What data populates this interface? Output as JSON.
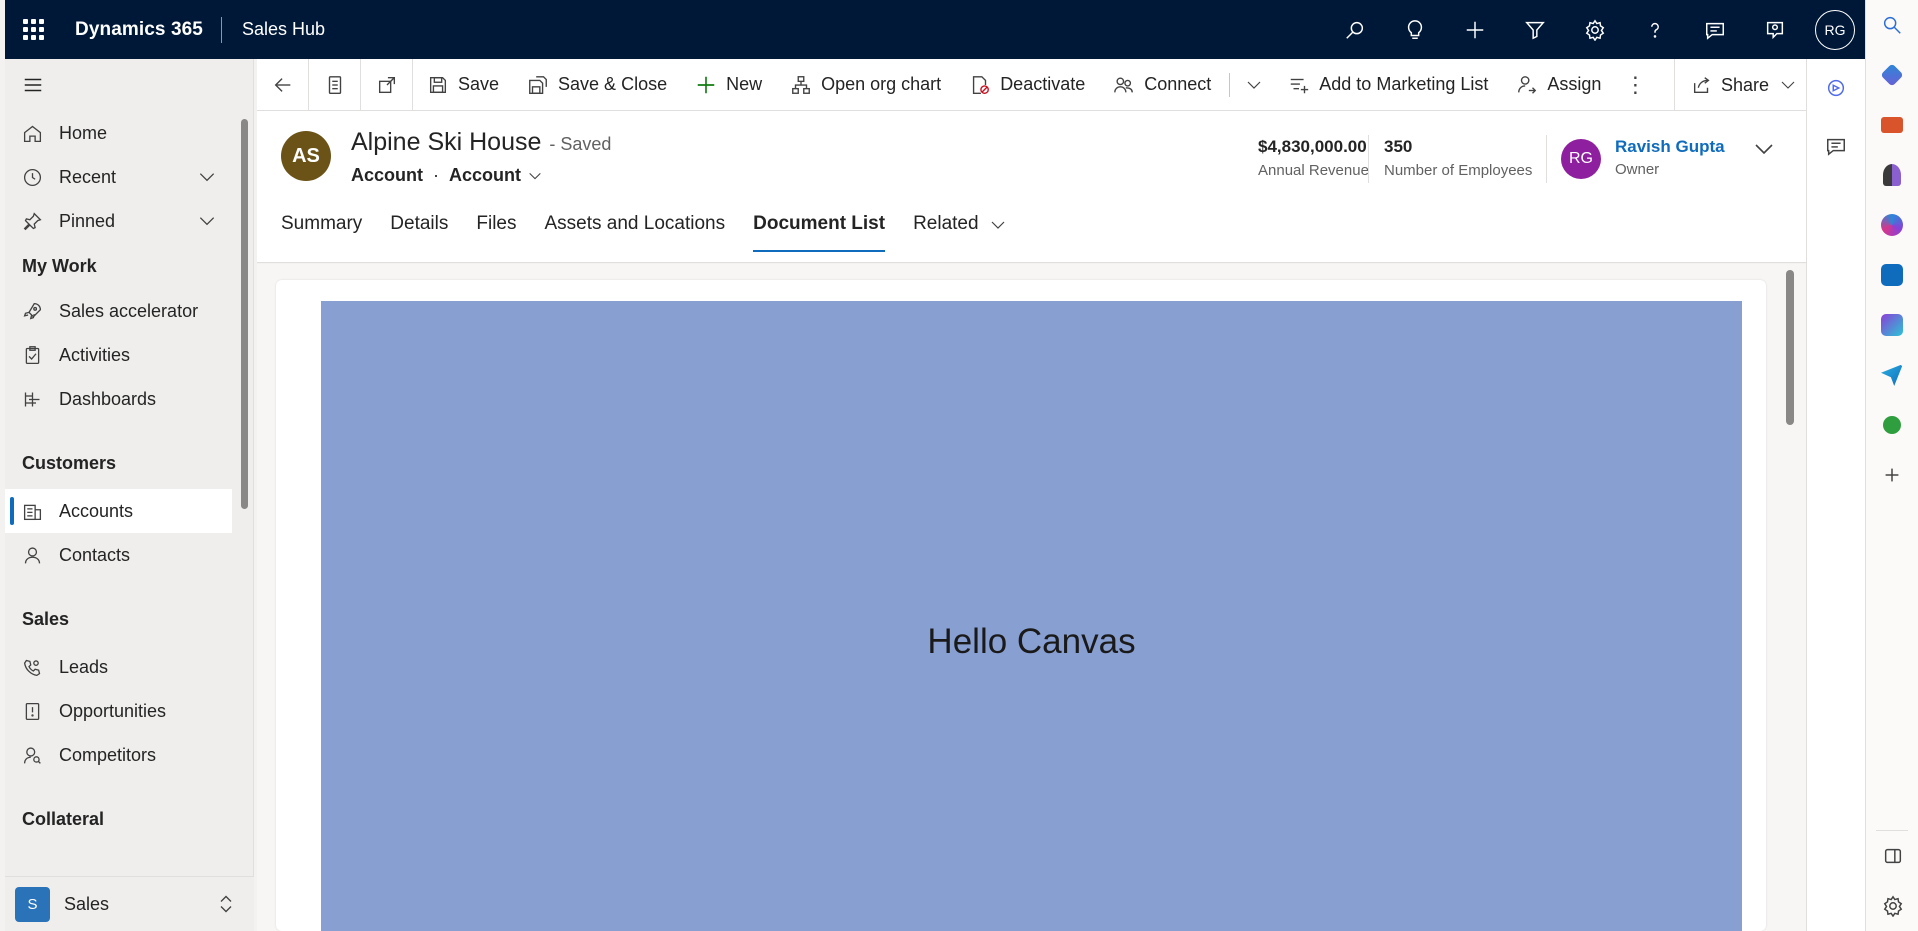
{
  "topbar": {
    "brand": "Dynamics 365",
    "app": "Sales Hub",
    "user_initials": "RG"
  },
  "nav": {
    "items_top": [
      {
        "label": "Home",
        "icon": "home-icon"
      },
      {
        "label": "Recent",
        "icon": "clock-icon",
        "has_chevron": true
      },
      {
        "label": "Pinned",
        "icon": "pin-icon",
        "has_chevron": true
      }
    ],
    "sections": [
      {
        "title": "My Work",
        "items": [
          {
            "label": "Sales accelerator",
            "icon": "rocket-icon"
          },
          {
            "label": "Activities",
            "icon": "clipboard-icon"
          },
          {
            "label": "Dashboards",
            "icon": "dashboard-icon"
          }
        ]
      },
      {
        "title": "Customers",
        "items": [
          {
            "label": "Accounts",
            "icon": "building-icon",
            "active": true
          },
          {
            "label": "Contacts",
            "icon": "person-icon"
          }
        ]
      },
      {
        "title": "Sales",
        "items": [
          {
            "label": "Leads",
            "icon": "phone-person-icon"
          },
          {
            "label": "Opportunities",
            "icon": "document-alert-icon"
          },
          {
            "label": "Competitors",
            "icon": "person-search-icon"
          }
        ]
      },
      {
        "title": "Collateral",
        "items": []
      }
    ],
    "area": {
      "badge": "S",
      "label": "Sales"
    }
  },
  "commands": {
    "save": "Save",
    "save_close": "Save & Close",
    "new": "New",
    "org_chart": "Open org chart",
    "deactivate": "Deactivate",
    "connect": "Connect",
    "marketing": "Add to Marketing List",
    "assign": "Assign",
    "share": "Share"
  },
  "record": {
    "initials": "AS",
    "title": "Alpine Ski House",
    "status": "- Saved",
    "entity": "Account",
    "form": "Account",
    "annual_revenue": "$4,830,000.00",
    "annual_revenue_label": "Annual Revenue",
    "employees": "350",
    "employees_label": "Number of Employees",
    "owner_initials": "RG",
    "owner_name": "Ravish Gupta",
    "owner_label": "Owner"
  },
  "tabs": [
    {
      "label": "Summary"
    },
    {
      "label": "Details"
    },
    {
      "label": "Files"
    },
    {
      "label": "Assets and Locations"
    },
    {
      "label": "Document List",
      "active": true
    },
    {
      "label": "Related",
      "has_chevron": true
    }
  ],
  "canvas": {
    "text": "Hello Canvas",
    "color": "#889fd1"
  },
  "colors": {
    "topbar": "#001838",
    "accent": "#0f6cbd",
    "record_avatar": "#6b5318",
    "owner_avatar": "#8e1f9e"
  }
}
